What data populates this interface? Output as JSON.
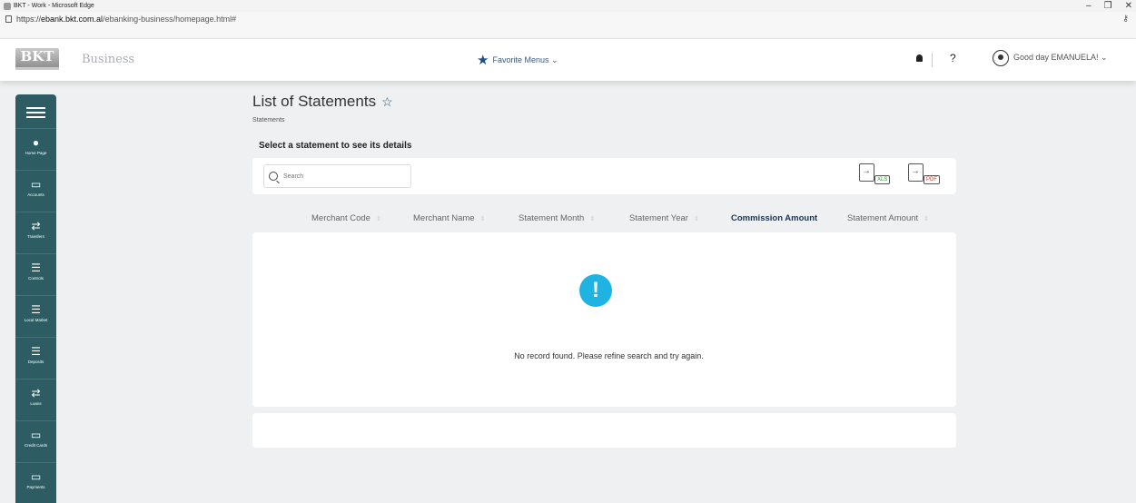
{
  "window": {
    "title": "BKT - Work - Microsoft Edge",
    "controls": [
      "–",
      "❐",
      "✕"
    ]
  },
  "address": {
    "prefix": "https://",
    "host": "ebank.bkt.com.al",
    "path": "/ebanking-business/homepage.html#"
  },
  "header": {
    "logo": "BKT",
    "brand": "Business",
    "favorite_menus": "Favorite Menus ⌄",
    "help": "?",
    "greeting": "Good day EMANUELA!  ⌄"
  },
  "sidebar": {
    "items": [
      {
        "label": "Home Page",
        "icon": "home-icon"
      },
      {
        "label": "Accounts",
        "icon": "accounts-icon"
      },
      {
        "label": "Transfers",
        "icon": "transfers-icon"
      },
      {
        "label": "Controls",
        "icon": "controls-icon"
      },
      {
        "label": "Local Market",
        "icon": "local-market-icon"
      },
      {
        "label": "Deposits",
        "icon": "deposits-icon"
      },
      {
        "label": "Loans",
        "icon": "loans-icon"
      },
      {
        "label": "Credit Cards",
        "icon": "credit-cards-icon"
      },
      {
        "label": "Payments",
        "icon": "payments-icon"
      }
    ]
  },
  "page": {
    "title": "List of Statements",
    "breadcrumb": "Statements",
    "subtitle": "Select a statement to see its details",
    "search_placeholder": "Search",
    "export_xls": "XLS",
    "export_pdf": "PDF"
  },
  "table": {
    "columns": [
      "Merchant Code",
      "Merchant Name",
      "Statement Month",
      "Statement Year",
      "Commission Amount",
      "Statement Amount"
    ],
    "active_column": "Commission Amount",
    "empty_message": "No record found. Please refine search and try again."
  },
  "colors": {
    "sidebar": "#2d5d63",
    "info": "#1eb3e2",
    "favorite_star": "#1f4e8c"
  }
}
